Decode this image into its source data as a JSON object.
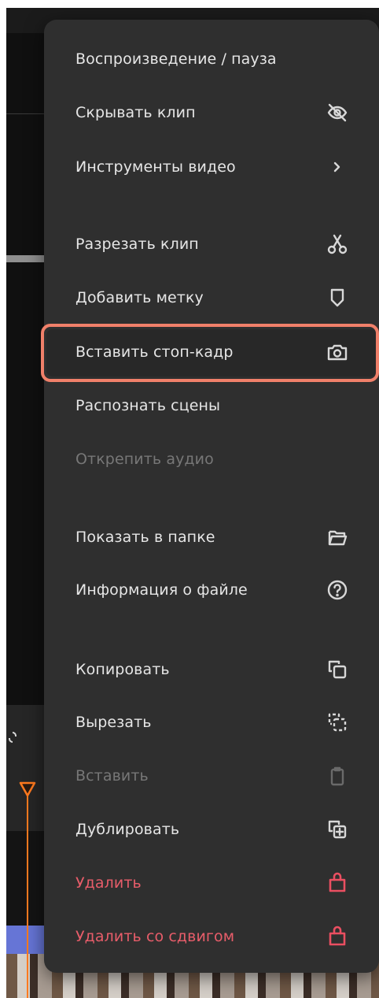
{
  "menu": {
    "items": [
      {
        "label": "Воспроизведение / пауза",
        "icon": "",
        "state": "enabled"
      },
      {
        "label": "Скрывать клип",
        "icon": "eye-off-icon",
        "state": "enabled"
      },
      {
        "label": "Инструменты видео",
        "icon": "chevron-right-icon",
        "state": "enabled"
      },
      {
        "label": "Разрезать клип",
        "icon": "scissors-icon",
        "state": "enabled"
      },
      {
        "label": "Добавить метку",
        "icon": "marker-icon",
        "state": "enabled"
      },
      {
        "label": "Вставить стоп-кадр",
        "icon": "camera-icon",
        "state": "highlighted"
      },
      {
        "label": "Распознать сцены",
        "icon": "",
        "state": "enabled"
      },
      {
        "label": "Открепить аудио",
        "icon": "",
        "state": "disabled"
      },
      {
        "label": "Показать в папке",
        "icon": "folder-icon",
        "state": "enabled"
      },
      {
        "label": "Информация о файле",
        "icon": "question-circle-icon",
        "state": "enabled"
      },
      {
        "label": "Копировать",
        "icon": "copy-icon",
        "state": "enabled"
      },
      {
        "label": "Вырезать",
        "icon": "cut-copy-icon",
        "state": "enabled"
      },
      {
        "label": "Вставить",
        "icon": "clipboard-icon",
        "state": "disabled"
      },
      {
        "label": "Дублировать",
        "icon": "duplicate-icon",
        "state": "enabled"
      },
      {
        "label": "Удалить",
        "icon": "trash-icon",
        "state": "danger"
      },
      {
        "label": "Удалить со сдвигом",
        "icon": "trash-icon",
        "state": "danger"
      }
    ]
  },
  "colors": {
    "menu_bg": "#2f2f2f",
    "text": "#e6e6e6",
    "disabled_text": "#777777",
    "danger_text": "#e85d6a",
    "highlight_outline": "#f0806a",
    "playhead": "#ff7a1f",
    "track": "#6675d6"
  }
}
